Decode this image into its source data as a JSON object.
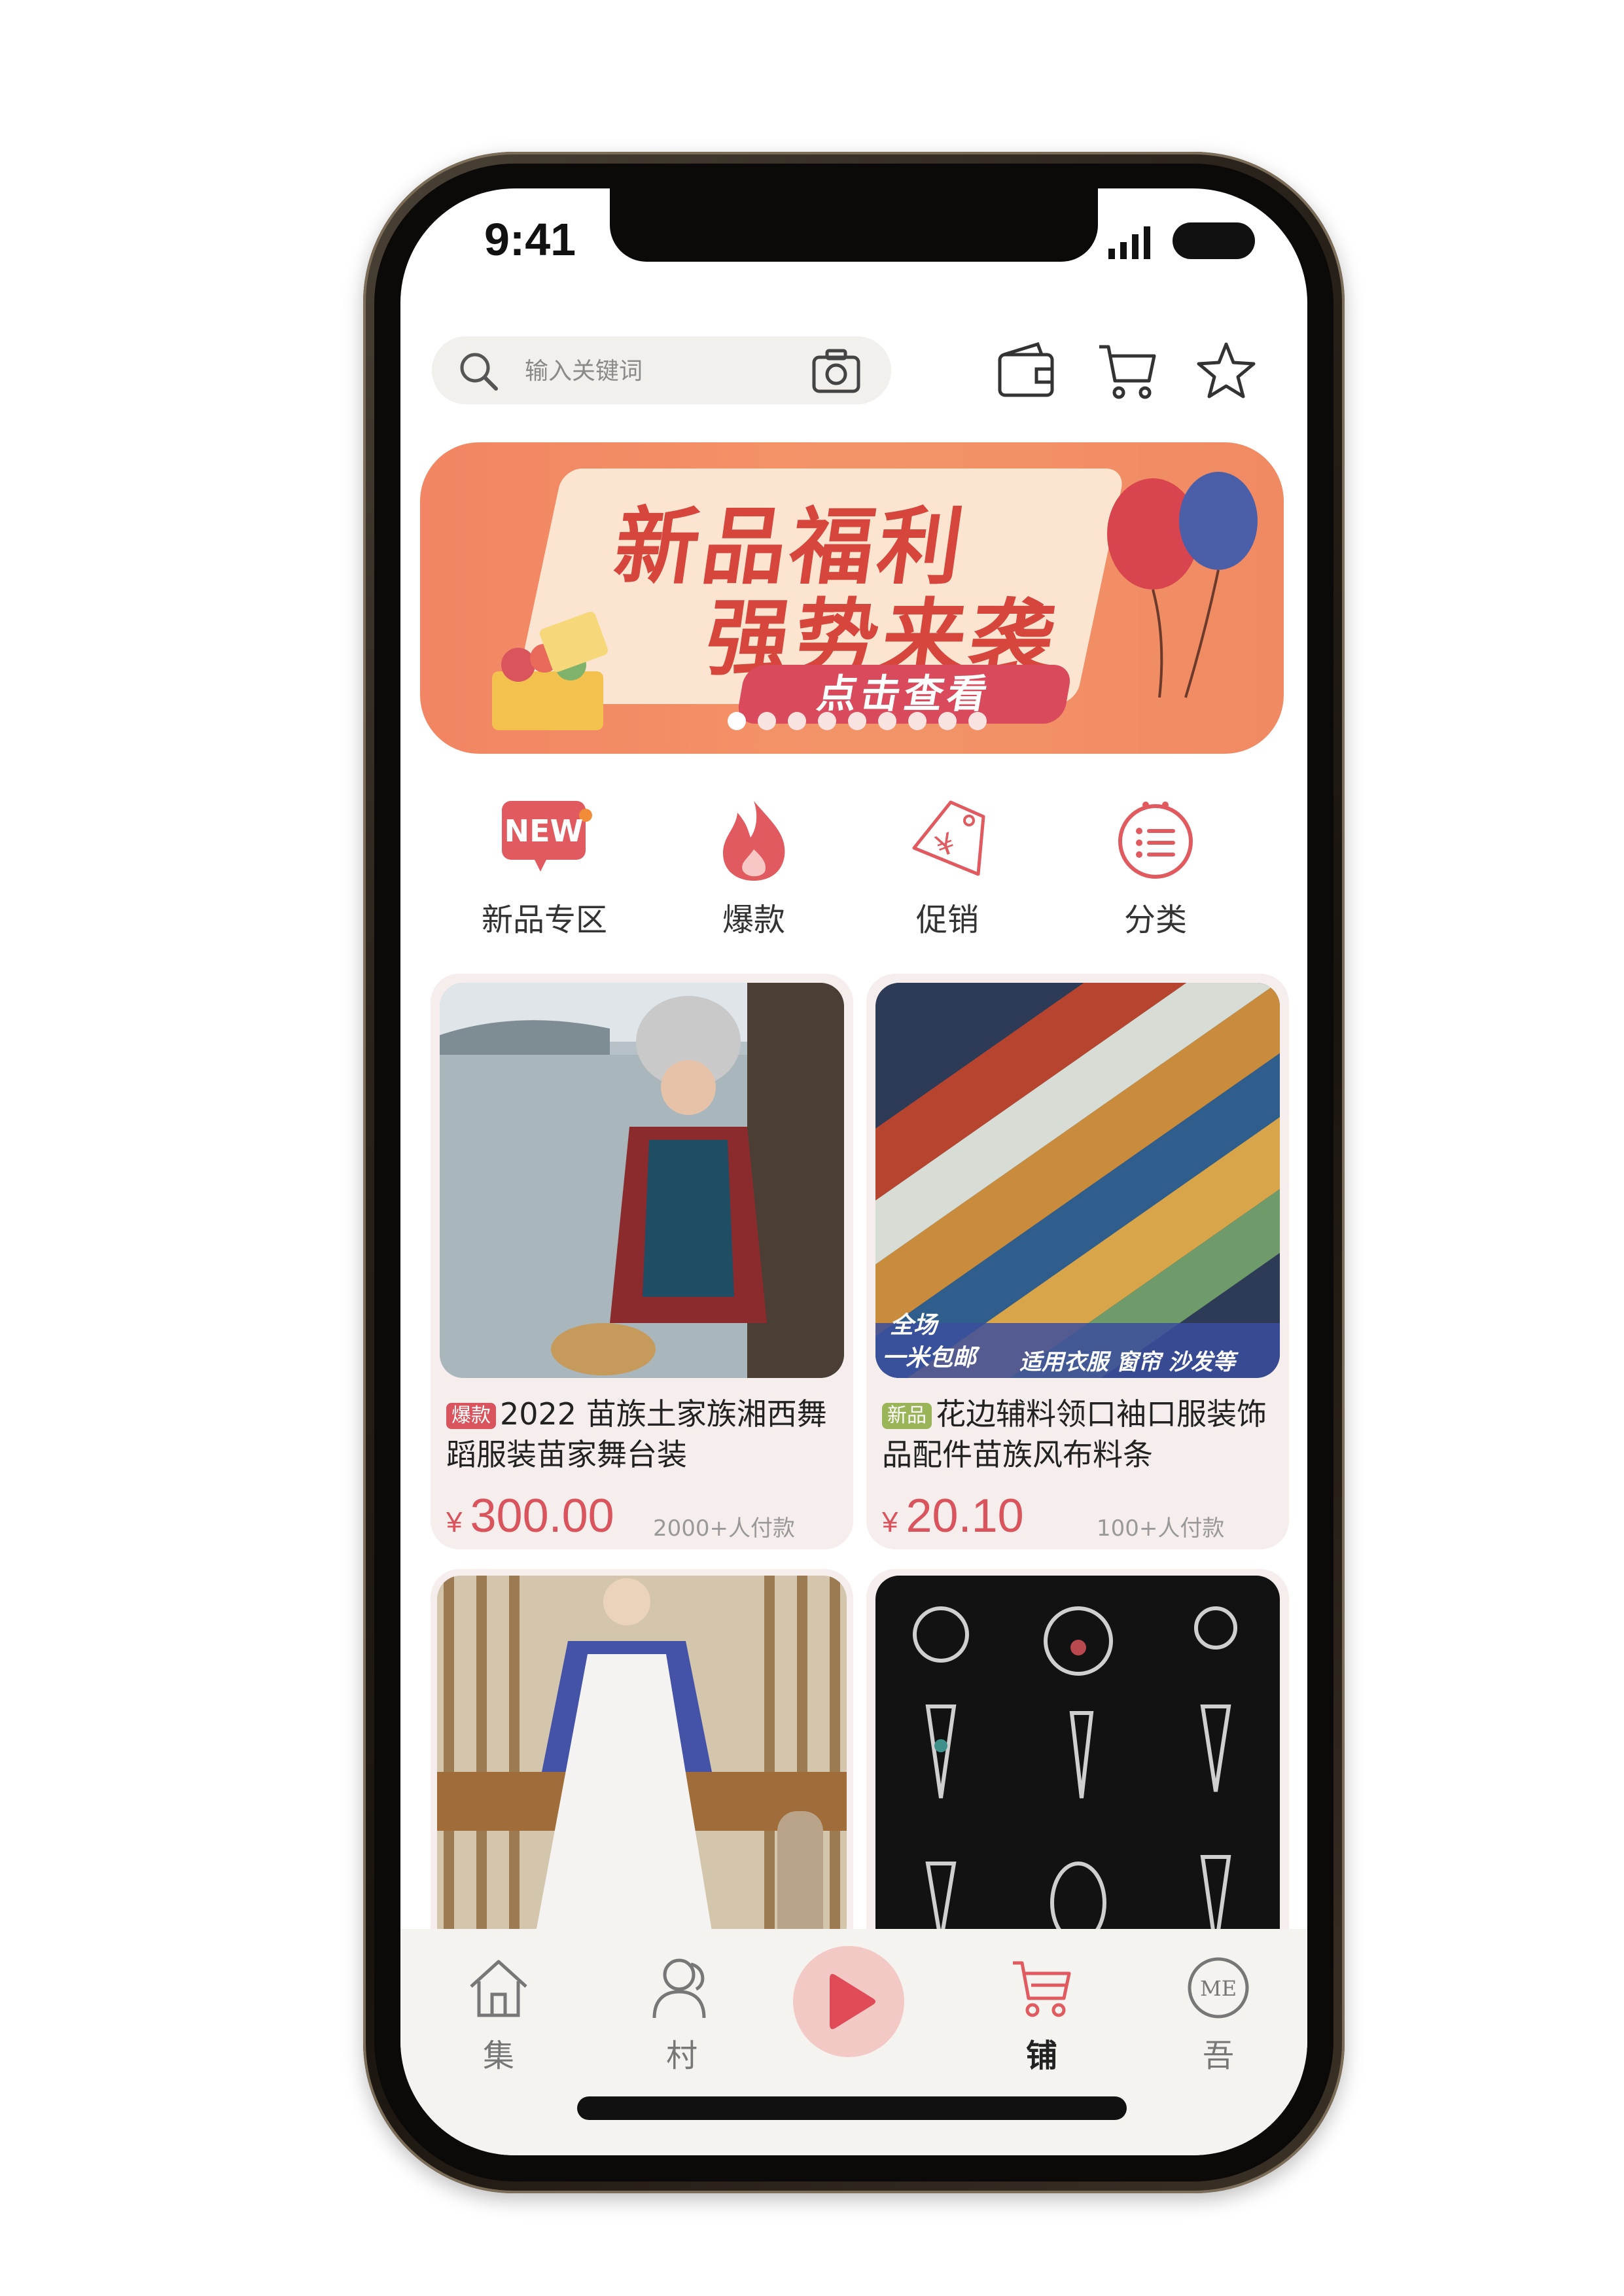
{
  "status_bar": {
    "time": "9:41"
  },
  "search": {
    "placeholder": "输入关键词"
  },
  "banner": {
    "line1": "新品福利",
    "line2": "强势来袭",
    "button_label": "点击查看",
    "dot_count": 9,
    "active_dot": 1
  },
  "quick_entries": [
    {
      "label": "新品专区",
      "badge": "NEW",
      "icon": "new-badge-icon"
    },
    {
      "label": "爆款",
      "icon": "flame-icon"
    },
    {
      "label": "促销",
      "icon": "price-tag-icon"
    },
    {
      "label": "分类",
      "icon": "category-icon"
    }
  ],
  "products": [
    {
      "tag": "爆款",
      "title": "2022 苗族土家族湘西舞蹈服装苗家舞台装",
      "currency": "¥",
      "price": "300.00",
      "sold": "2000+人付款",
      "image": "woman-in-miao-costume-by-lake"
    },
    {
      "tag": "新品",
      "title": "花边辅料领口袖口服装饰品配件苗族风布料条",
      "currency": "¥",
      "price": "20.10",
      "sold": "100+人付款",
      "image": "embroidered-lace-ribbons",
      "overlay_left_1": "全场",
      "overlay_left_2": "一米包邮",
      "overlay_right": "适用衣服 窗帘 沙发等"
    },
    {
      "image": "woman-in-blue-white-hanbok"
    },
    {
      "image": "silver-earrings-grid"
    }
  ],
  "tabbar": [
    {
      "label": "集",
      "icon": "home-icon"
    },
    {
      "label": "村",
      "icon": "person-icon"
    },
    {
      "label": "",
      "icon": "play-icon"
    },
    {
      "label": "铺",
      "icon": "cart-icon",
      "active": true
    },
    {
      "label": "吾",
      "icon": "me-icon",
      "icon_text": "ME"
    }
  ],
  "colors": {
    "accent": "#d9545d",
    "banner": "#f28563",
    "card_bg": "#f6eeed",
    "new_tag": "#9ab558"
  }
}
